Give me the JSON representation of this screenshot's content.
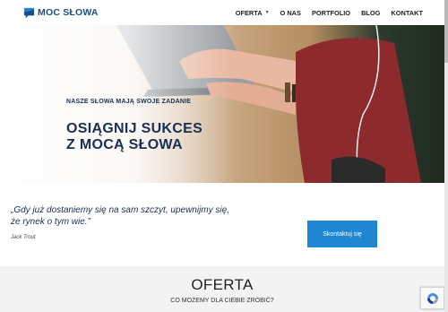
{
  "header": {
    "logo_text": "MOC SŁOWA",
    "nav": [
      {
        "label": "OFERTA",
        "has_dropdown": true
      },
      {
        "label": "O NAS"
      },
      {
        "label": "PORTFOLIO"
      },
      {
        "label": "BLOG"
      },
      {
        "label": "KONTAKT"
      }
    ]
  },
  "hero": {
    "subtitle": "NASZE SŁOWA MAJĄ SWOJE ZADANIE",
    "title_line1": "OSIĄGNIJ SUKCES",
    "title_line2": "Z MOCĄ SŁOWA"
  },
  "quote": {
    "line1": "„Gdy już dostaniemy się na sam szczyt, upewnijmy się,",
    "line2": "że rynek o tym wie.”",
    "author": "Jack Trout"
  },
  "cta": {
    "label": "Skontaktuj się"
  },
  "offer": {
    "title": "OFERTA",
    "subtitle": "CO MOŻEMY DLA CIEBIE ZROBIĆ?"
  },
  "colors": {
    "brand_navy": "#1a2f55",
    "logo_blue": "#1b4e86",
    "cta_blue": "#1f86d1"
  },
  "icons": {
    "logo": "speech-bubble-logo-icon",
    "caret": "caret-down-icon",
    "recaptcha": "recaptcha-icon"
  }
}
